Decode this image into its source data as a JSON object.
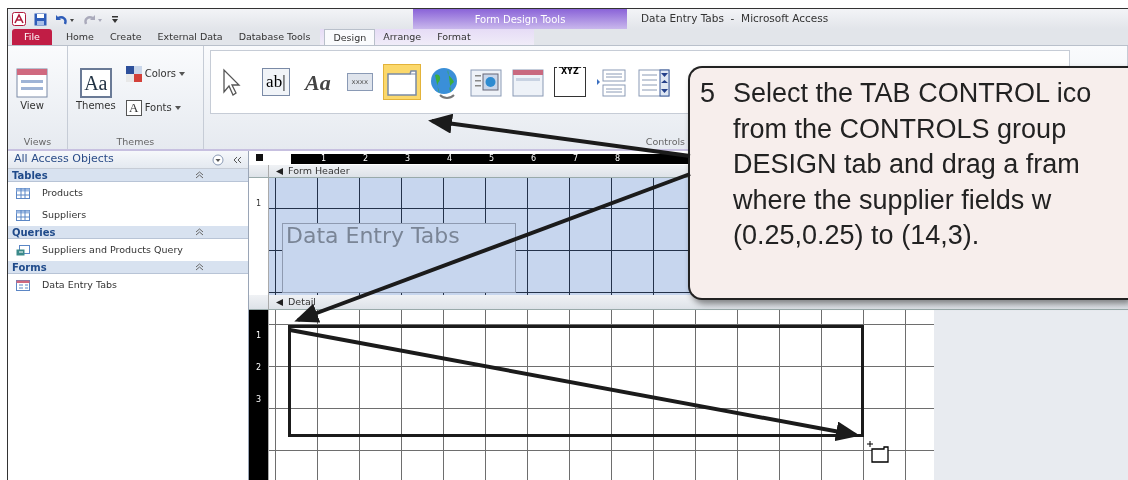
{
  "title_bar": {
    "contextual_tab": "Form Design Tools",
    "title": "Data Entry Tabs  -  Microsoft Access"
  },
  "tabs": [
    {
      "label": "File",
      "kind": "file",
      "selected": false
    },
    {
      "label": "Home",
      "kind": "tab",
      "selected": false
    },
    {
      "label": "Create",
      "kind": "tab",
      "selected": false
    },
    {
      "label": "External Data",
      "kind": "tab",
      "selected": false
    },
    {
      "label": "Database Tools",
      "kind": "tab",
      "selected": false
    },
    {
      "label": "Design",
      "kind": "contextual",
      "selected": true
    },
    {
      "label": "Arrange",
      "kind": "contextual",
      "selected": false
    },
    {
      "label": "Format",
      "kind": "contextual",
      "selected": false
    }
  ],
  "ribbon": {
    "view_button": "View",
    "themes_button": "Themes",
    "themes_glyph": "Aa",
    "colors_button": "Colors",
    "fonts_button": "Fonts",
    "fonts_glyph": "A",
    "groups": [
      "Views",
      "Themes",
      "Controls"
    ],
    "controls": [
      {
        "kind": "pointer",
        "selected": false
      },
      {
        "kind": "textbox",
        "glyph": "ab|",
        "selected": false
      },
      {
        "kind": "label",
        "glyph": "Aa",
        "selected": false
      },
      {
        "kind": "button",
        "glyph": "xxxx",
        "selected": false
      },
      {
        "kind": "tab",
        "selected": true
      },
      {
        "kind": "hyperlink",
        "selected": false
      },
      {
        "kind": "image",
        "selected": false
      },
      {
        "kind": "window",
        "selected": false
      },
      {
        "kind": "frame",
        "glyph": "XYZ",
        "selected": false
      },
      {
        "kind": "list",
        "selected": false
      },
      {
        "kind": "combo",
        "selected": false
      }
    ]
  },
  "nav_pane": {
    "title": "All Access Objects",
    "groups": [
      {
        "label": "Tables",
        "expanded": true,
        "items": [
          {
            "label": "Products",
            "kind": "table"
          },
          {
            "label": "Suppliers",
            "kind": "table"
          }
        ]
      },
      {
        "label": "Queries",
        "expanded": true,
        "items": [
          {
            "label": "Suppliers and Products Query",
            "kind": "query"
          }
        ]
      },
      {
        "label": "Forms",
        "expanded": true,
        "items": [
          {
            "label": "Data Entry Tabs",
            "kind": "form"
          }
        ]
      }
    ]
  },
  "designer": {
    "h_ruler": [
      "1",
      "2",
      "3",
      "4",
      "5",
      "6",
      "7",
      "8"
    ],
    "sections": [
      {
        "label": "Form Header",
        "kind": "header",
        "v_ruler": [
          "1"
        ],
        "label_control": "Data Entry Tabs"
      },
      {
        "label": "Detail",
        "kind": "detail",
        "v_ruler": [
          "1",
          "2",
          "3"
        ]
      }
    ]
  },
  "callout": {
    "number": "5",
    "lines": [
      "Select the TAB CONTROL ico",
      "from the CONTROLS group",
      "DESIGN tab and drag a fram",
      "where the supplier fields w",
      "(0.25,0.25) to (14,3)."
    ]
  }
}
